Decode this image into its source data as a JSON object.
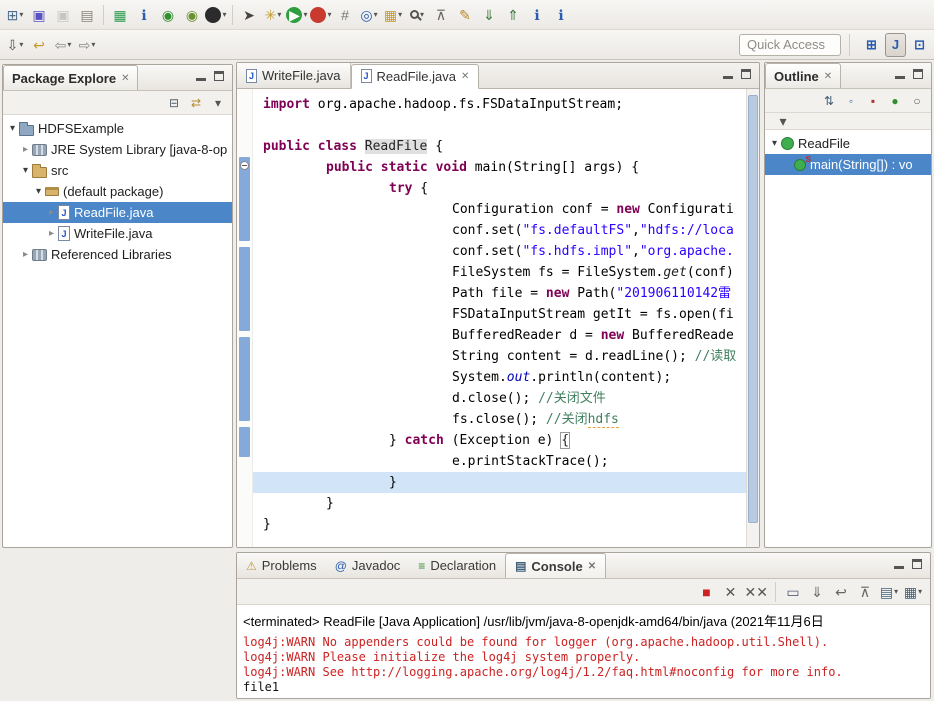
{
  "ui": {
    "close": "✕",
    "dropdown": "▾",
    "expander_open": "▾",
    "expander_closed": "▸"
  },
  "toolbar_main": {
    "icons": [
      {
        "name": "new-wizard-button",
        "glyph": "⊞",
        "color": "#4f6f91",
        "dd": true
      },
      {
        "name": "save-button",
        "glyph": "▣",
        "color": "#5a52c0"
      },
      {
        "name": "save-all-button",
        "glyph": "▣",
        "color": "#8d8b87",
        "disabled": true
      },
      {
        "name": "print-button",
        "glyph": "▤",
        "color": "#87837c"
      },
      {
        "sep": true
      },
      {
        "name": "new-java-project-button",
        "glyph": "▦",
        "color": "#2f9e4f"
      },
      {
        "name": "new-class-button",
        "glyph": "ℹ",
        "color": "#2a5db0"
      },
      {
        "name": "open-type-button",
        "glyph": "◉",
        "color": "#2f8f2f"
      },
      {
        "name": "junit-button",
        "glyph": "◉",
        "color": "#6a8f2f"
      },
      {
        "name": "user-button",
        "glyph": "",
        "bg": "#2b2b2b",
        "dd": true
      },
      {
        "sep": true
      },
      {
        "name": "select-tool-button",
        "glyph": "➤",
        "color": "#444"
      },
      {
        "name": "new-menu-button",
        "glyph": "✳",
        "color": "#c79b2e",
        "dd": true
      },
      {
        "name": "run-button",
        "glyph": "▶",
        "bg": "#2f9e3f",
        "dd": true
      },
      {
        "name": "profile-button",
        "glyph": "",
        "bg": "#c8392e",
        "dd": true
      },
      {
        "name": "grid-button",
        "glyph": "#",
        "color": "#777"
      },
      {
        "name": "open-browser-button",
        "glyph": "◎",
        "color": "#2a5db0",
        "dd": true
      },
      {
        "name": "open-task-button",
        "glyph": "▦",
        "color": "#c79b2e",
        "dd": true
      },
      {
        "name": "search-button",
        "cls": "search-shape",
        "dd": true
      },
      {
        "name": "pin-editor-button",
        "glyph": "⊼",
        "color": "#666"
      },
      {
        "name": "mark-occurrences-button",
        "glyph": "✎",
        "color": "#b58a2e"
      },
      {
        "name": "next-annotation-button",
        "glyph": "⇓",
        "color": "#3a7a3a"
      },
      {
        "name": "previous-annotation-button",
        "glyph": "⇑",
        "color": "#3a7a3a"
      },
      {
        "name": "show-source-button",
        "glyph": "ℹ",
        "color": "#2a5db0"
      },
      {
        "name": "show-javadoc-button",
        "glyph": "ℹ",
        "color": "#2a5db0"
      }
    ]
  },
  "toolbar_nav": {
    "icons": [
      {
        "name": "back-to-last-edit-button",
        "glyph": "⇩",
        "color": "#555",
        "dd": true
      },
      {
        "name": "last-edit-location-button",
        "glyph": "↩",
        "color": "#c79b2e"
      },
      {
        "name": "back-button",
        "glyph": "⇦",
        "color": "#8a8a8a",
        "dd": true
      },
      {
        "name": "forward-button",
        "glyph": "⇨",
        "color": "#8a8a8a",
        "dd": true
      }
    ],
    "quick_access": "Quick Access",
    "perspectives": [
      {
        "name": "open-perspective-button",
        "glyph": "⊞"
      },
      {
        "name": "java-perspective-button",
        "glyph": "J",
        "active": true
      },
      {
        "name": "javaee-perspective-button",
        "glyph": "⊡"
      }
    ]
  },
  "package_explorer": {
    "title": "Package Explore",
    "toolbar": [
      {
        "name": "collapse-all-button",
        "glyph": "⊟",
        "color": "#55606b"
      },
      {
        "name": "link-with-editor-button",
        "glyph": "⇄",
        "color": "#b58a2e"
      },
      {
        "name": "view-menu-button",
        "glyph": "▾",
        "color": "#555"
      }
    ],
    "items": [
      {
        "label": "HDFSExample",
        "level": 0,
        "expand": "open",
        "icon": "icon-project"
      },
      {
        "label": "JRE System Library [java-8-op",
        "level": 1,
        "expand": "closed",
        "icon": "icon-library"
      },
      {
        "label": "src",
        "level": 1,
        "expand": "open",
        "icon": "icon-srcfolder"
      },
      {
        "label": "(default package)",
        "level": 2,
        "expand": "open",
        "icon": "icon-package"
      },
      {
        "label": "ReadFile.java",
        "level": 3,
        "expand": "closed",
        "icon": "icon-jfile",
        "selected": true
      },
      {
        "label": "WriteFile.java",
        "level": 3,
        "expand": "closed",
        "icon": "icon-jfile"
      },
      {
        "label": "Referenced Libraries",
        "level": 1,
        "expand": "closed",
        "icon": "icon-library"
      }
    ]
  },
  "editor": {
    "tabs": [
      {
        "label": "WriteFile.java"
      },
      {
        "label": "ReadFile.java",
        "active": true
      }
    ],
    "code_lines": [
      {
        "i": 0,
        "t": [
          [
            "k",
            "import"
          ],
          [
            "d",
            " org.apache.hadoop.fs.FSDataInputStream;"
          ]
        ]
      },
      {
        "i": 0,
        "t": []
      },
      {
        "i": 0,
        "t": [
          [
            "k",
            "public"
          ],
          [
            "d",
            " "
          ],
          [
            "k",
            "class"
          ],
          [
            "d",
            " "
          ],
          [
            "occ",
            "ReadFile"
          ],
          [
            "d",
            " {"
          ]
        ]
      },
      {
        "i": 1,
        "t": [
          [
            "k",
            "public"
          ],
          [
            "d",
            " "
          ],
          [
            "k",
            "static"
          ],
          [
            "d",
            " "
          ],
          [
            "k",
            "void"
          ],
          [
            "d",
            " main(String[] args) {"
          ]
        ]
      },
      {
        "i": 2,
        "t": [
          [
            "k",
            "try"
          ],
          [
            "d",
            " {"
          ]
        ]
      },
      {
        "i": 3,
        "t": [
          [
            "d",
            "Configuration conf = "
          ],
          [
            "k",
            "new"
          ],
          [
            "d",
            " Configurati"
          ]
        ]
      },
      {
        "i": 3,
        "t": [
          [
            "d",
            "conf.set("
          ],
          [
            "s",
            "\"fs.defaultFS\""
          ],
          [
            "d",
            ","
          ],
          [
            "s",
            "\"hdfs://loca"
          ]
        ]
      },
      {
        "i": 3,
        "t": [
          [
            "d",
            "conf.set("
          ],
          [
            "s",
            "\"fs.hdfs.impl\""
          ],
          [
            "d",
            ","
          ],
          [
            "s",
            "\"org.apache."
          ]
        ]
      },
      {
        "i": 3,
        "t": [
          [
            "d",
            "FileSystem fs = FileSystem."
          ],
          [
            "m",
            "get"
          ],
          [
            "d",
            "(conf)"
          ]
        ]
      },
      {
        "i": 3,
        "t": [
          [
            "d",
            "Path file = "
          ],
          [
            "k",
            "new"
          ],
          [
            "d",
            " Path("
          ],
          [
            "s",
            "\"201906110142雷"
          ]
        ]
      },
      {
        "i": 3,
        "t": [
          [
            "d",
            "FSDataInputStream getIt = fs.open(fi"
          ]
        ]
      },
      {
        "i": 3,
        "t": [
          [
            "d",
            "BufferedReader d = "
          ],
          [
            "k",
            "new"
          ],
          [
            "d",
            " BufferedReade"
          ]
        ]
      },
      {
        "i": 3,
        "t": [
          [
            "d",
            "String content = d.readLine(); "
          ],
          [
            "c",
            "//读取"
          ]
        ]
      },
      {
        "i": 3,
        "t": [
          [
            "d",
            "System."
          ],
          [
            "f",
            "out"
          ],
          [
            "d",
            ".println(content);"
          ]
        ]
      },
      {
        "i": 3,
        "t": [
          [
            "d",
            "d.close(); "
          ],
          [
            "c",
            "//关闭文件"
          ]
        ]
      },
      {
        "i": 3,
        "t": [
          [
            "d",
            "fs.close(); "
          ],
          [
            "c",
            "//关闭"
          ],
          [
            "cm",
            "hdfs"
          ]
        ]
      },
      {
        "i": 2,
        "t": [
          [
            "d",
            "} "
          ],
          [
            "k",
            "catch"
          ],
          [
            "d",
            " (Exception e) "
          ],
          [
            "bm",
            "{"
          ]
        ]
      },
      {
        "i": 3,
        "t": [
          [
            "d",
            "e.printStackTrace();"
          ]
        ]
      },
      {
        "i": 2,
        "hl": true,
        "t": [
          [
            "d",
            "}"
          ]
        ]
      },
      {
        "i": 1,
        "t": [
          [
            "d",
            "}"
          ]
        ]
      },
      {
        "i": 0,
        "t": [
          [
            "d",
            "}"
          ]
        ]
      }
    ]
  },
  "outline": {
    "title": "Outline",
    "toolbar": [
      {
        "name": "sort-button",
        "glyph": "⇅",
        "color": "#44617b"
      },
      {
        "name": "hide-fields-button",
        "glyph": "◦",
        "color": "#2a5db0"
      },
      {
        "name": "hide-static-button",
        "glyph": "▪",
        "color": "#a33"
      },
      {
        "name": "hide-non-public-button",
        "glyph": "●",
        "color": "#2f8f2f"
      },
      {
        "name": "hide-local-types-button",
        "glyph": "○",
        "color": "#555"
      }
    ],
    "toolbar2": [
      {
        "name": "view-menu-button",
        "glyph": "▾",
        "color": "#555"
      }
    ],
    "items": [
      {
        "label": "ReadFile",
        "level": 0,
        "expand": "open",
        "icon": "icon-class"
      },
      {
        "label": "main(String[]) : vo",
        "level": 1,
        "expand": "none",
        "icon": "icon-method",
        "static": true,
        "selected": true
      }
    ]
  },
  "console": {
    "tabs": [
      {
        "label": "Problems",
        "icon_glyph": "⚠",
        "icon_color": "#c09a3a"
      },
      {
        "label": "Javadoc",
        "icon_glyph": "@",
        "icon_color": "#2a5db0"
      },
      {
        "label": "Declaration",
        "icon_glyph": "≡",
        "icon_color": "#3a8c3a"
      },
      {
        "label": "Console",
        "icon_glyph": "▤",
        "icon_color": "#44617b",
        "active": true
      }
    ],
    "toolbar": [
      {
        "name": "terminate-button",
        "glyph": "■",
        "color": "#cc2222"
      },
      {
        "name": "remove-launch-button",
        "glyph": "✕",
        "color": "#555"
      },
      {
        "name": "remove-all-launches-button",
        "glyph": "✕✕",
        "color": "#555"
      },
      {
        "sep": true
      },
      {
        "name": "clear-console-button",
        "glyph": "▭",
        "color": "#55607b"
      },
      {
        "name": "scroll-lock-button",
        "glyph": "⇓",
        "color": "#666"
      },
      {
        "name": "word-wrap-button",
        "glyph": "↩",
        "color": "#666"
      },
      {
        "name": "pin-console-button",
        "glyph": "⊼",
        "color": "#666"
      },
      {
        "name": "display-console-button",
        "glyph": "▤",
        "color": "#44617b",
        "dd": true
      },
      {
        "name": "open-console-button",
        "glyph": "▦",
        "color": "#44617b",
        "dd": true
      }
    ],
    "header": "<terminated> ReadFile [Java Application] /usr/lib/jvm/java-8-openjdk-amd64/bin/java (2021年11月6日",
    "lines": [
      {
        "kind": "stderr",
        "text": "log4j:WARN No appenders could be found for logger (org.apache.hadoop.util.Shell)."
      },
      {
        "kind": "stderr",
        "text": "log4j:WARN Please initialize the log4j system properly."
      },
      {
        "kind": "stderr",
        "text": "log4j:WARN See http://logging.apache.org/log4j/1.2/faq.html#noconfig for more info."
      },
      {
        "kind": "stdout",
        "text": "file1"
      }
    ]
  }
}
